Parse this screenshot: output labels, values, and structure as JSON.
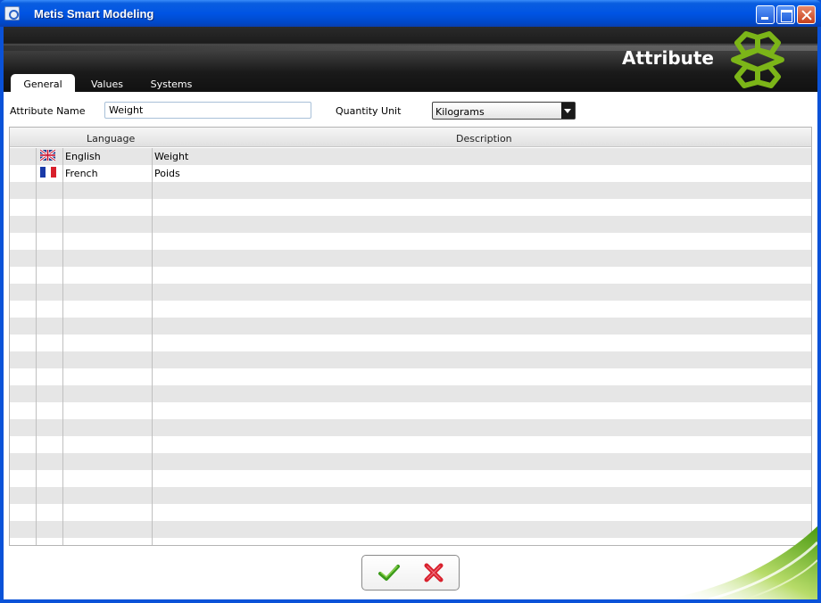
{
  "window": {
    "title": "Metis Smart Modeling"
  },
  "header": {
    "section_title": "Attribute"
  },
  "tabs": [
    {
      "label": "General",
      "active": true
    },
    {
      "label": "Values",
      "active": false
    },
    {
      "label": "Systems",
      "active": false
    }
  ],
  "form": {
    "attribute_name_label": "Attribute Name",
    "attribute_name_value": "Weight",
    "quantity_unit_label": "Quantity Unit",
    "quantity_unit_value": "Kilograms"
  },
  "grid": {
    "columns": [
      "Language",
      "Description"
    ],
    "rows": [
      {
        "flag": "uk-flag-icon",
        "language": "English",
        "description": "Weight"
      },
      {
        "flag": "france-flag-icon",
        "language": "French",
        "description": "Poids"
      }
    ]
  },
  "buttons": {
    "ok_icon": "checkmark-icon",
    "cancel_icon": "cross-icon"
  },
  "colors": {
    "titlebar": "#0054e3",
    "header_band": "#1c1c1c",
    "accent_green": "#7cb518",
    "cancel_red": "#d8202c",
    "row_alt": "#e6e6e6"
  }
}
